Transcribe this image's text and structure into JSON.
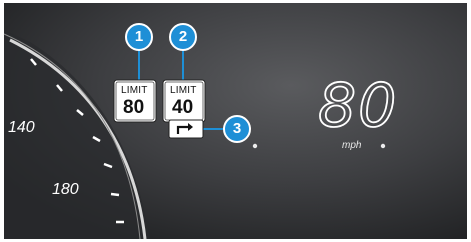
{
  "speed_limit_signs": [
    {
      "word": "LIMIT",
      "value": "80"
    },
    {
      "word": "LIMIT",
      "value": "40"
    }
  ],
  "current_speed": {
    "value": "80",
    "unit": "mph"
  },
  "gauge": {
    "tick_labels": [
      "140",
      "180"
    ]
  },
  "callouts": [
    "1",
    "2",
    "3"
  ],
  "icons": {
    "turn_sign": "right-turn-arrow-icon"
  },
  "colors": {
    "callout": "#1e8fd6",
    "background": "#3a3b3d"
  }
}
